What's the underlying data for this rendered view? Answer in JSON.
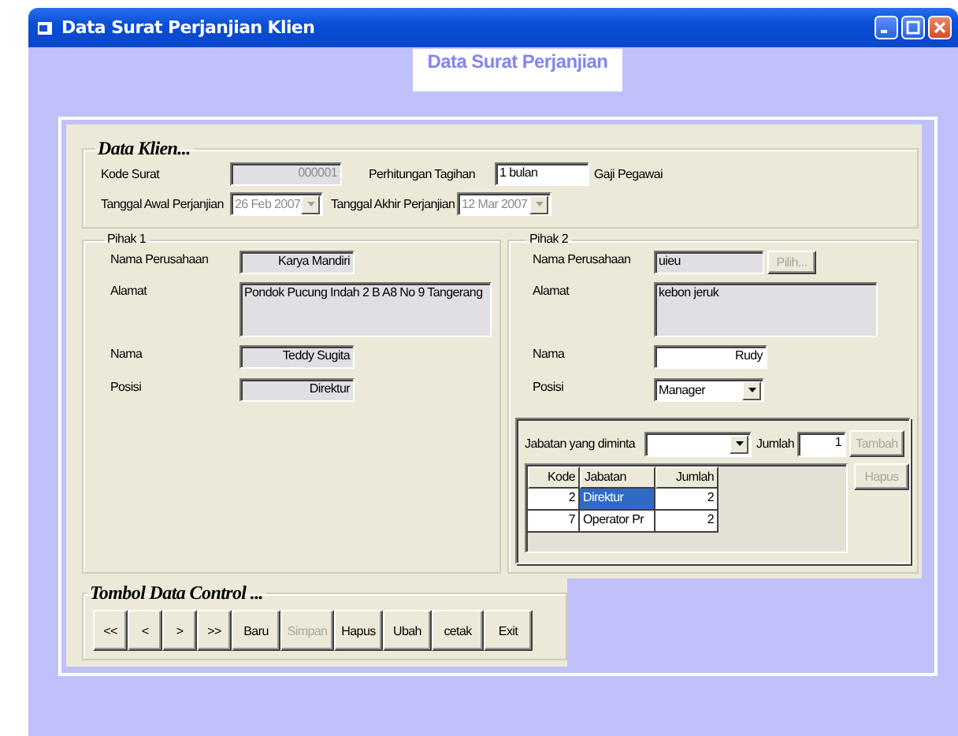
{
  "window": {
    "title": "Data Surat Perjanjian Klien"
  },
  "header": {
    "title": "Data Surat Perjanjian"
  },
  "data_klien": {
    "title": "Data Klien...",
    "fields": [
      {
        "label": "Kode Surat",
        "kind": "text",
        "value": "000001",
        "disabled": true
      },
      {
        "label": "Perhitungan Tagihan",
        "kind": "text",
        "value": "1 bulan",
        "disabled": false,
        "suffix": "Gaji Pegawai"
      },
      {
        "label": "Tanggal Awal Perjanjian",
        "kind": "dropdown",
        "value": "26 Feb 2007",
        "disabled": true
      },
      {
        "label": "Tanggal Akhir Perjanjian",
        "kind": "dropdown",
        "value": "12 Mar 2007",
        "disabled": true
      }
    ]
  },
  "pihak_1": {
    "title": "Pihak 1",
    "fields": [
      {
        "label": "Nama Perusahaan",
        "kind": "text",
        "value": "Karya Mandiri",
        "readonly": true
      },
      {
        "label": "Alamat",
        "kind": "memo",
        "value": "Pondok Pucung Indah 2 B A8 No 9 Tangerang",
        "readonly": true
      },
      {
        "label": "Nama",
        "kind": "text",
        "value": "Teddy Sugita",
        "readonly": true
      },
      {
        "label": "Posisi",
        "kind": "text",
        "value": "Direktur",
        "readonly": true
      }
    ]
  },
  "pihak_2": {
    "title": "Pihak 2",
    "fields": [
      {
        "label": "Nama Perusahaan",
        "kind": "text",
        "value": "uieu",
        "readonly": true,
        "button": {
          "label": "Pilih...",
          "disabled": true
        }
      },
      {
        "label": "Alamat",
        "kind": "memo",
        "value": "kebon jeruk",
        "readonly": true
      },
      {
        "label": "Nama",
        "kind": "text",
        "value": "Rudy",
        "readonly": false
      },
      {
        "label": "Posisi",
        "kind": "dropdown",
        "value": "Manager",
        "readonly": false
      }
    ],
    "jabatan": {
      "label": "Jabatan yang diminta",
      "jumlah_label": "Jumlah",
      "jumlah_value": "1",
      "buttons": [
        {
          "label": "Tambah",
          "disabled": true
        },
        {
          "label": "Hapus",
          "disabled": true
        }
      ],
      "table": {
        "columns": [
          "Kode",
          "Jabatan",
          "Jumlah"
        ],
        "rows": [
          {
            "cells": [
              "2",
              "Direktur",
              "2"
            ],
            "selected": true
          },
          {
            "cells": [
              "7",
              "Operator Pr",
              "2"
            ],
            "selected": false
          }
        ]
      }
    }
  },
  "tombol": {
    "title": "Tombol Data Control ...",
    "buttons": [
      {
        "label": "<<",
        "disabled": false
      },
      {
        "label": "<",
        "disabled": false
      },
      {
        "label": ">",
        "disabled": false
      },
      {
        "label": ">>",
        "disabled": false
      },
      {
        "label": "Baru",
        "disabled": false
      },
      {
        "label": "Simpan",
        "disabled": true
      },
      {
        "label": "Hapus",
        "disabled": false
      },
      {
        "label": "Ubah",
        "disabled": false
      },
      {
        "label": "cetak",
        "disabled": false
      },
      {
        "label": "Exit",
        "disabled": false
      }
    ]
  }
}
